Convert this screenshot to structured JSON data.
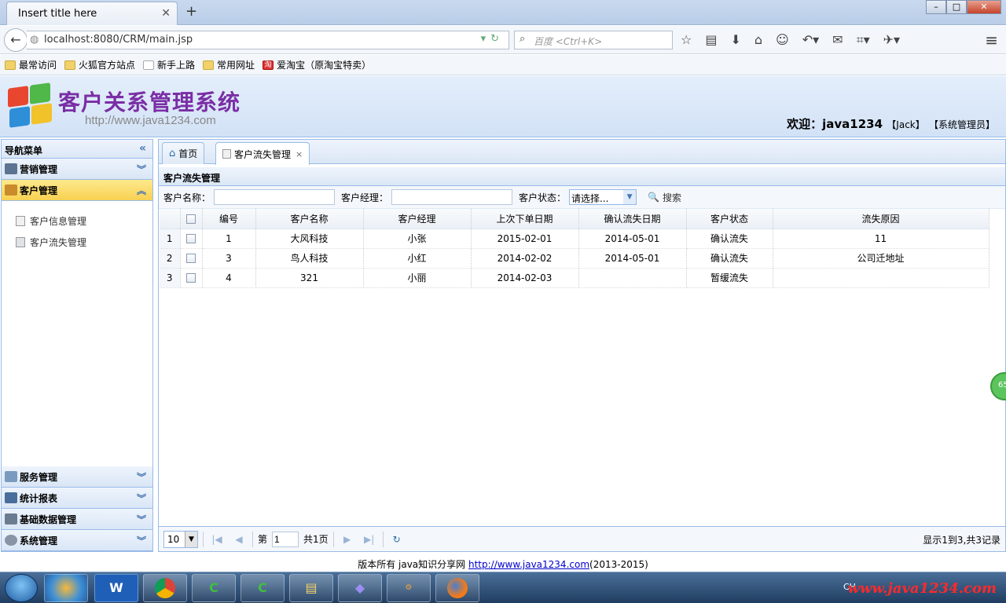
{
  "browser": {
    "tab_title": "Insert title here",
    "tab_close": "✕",
    "new_tab": "+",
    "url": "localhost:8080/CRM/main.jsp",
    "search_placeholder": "百度 <Ctrl+K>",
    "bookmarks": [
      "最常访问",
      "火狐官方站点",
      "新手上路",
      "常用网址",
      "爱淘宝（原淘宝特卖）"
    ]
  },
  "header": {
    "app_title": "客户关系管理系统",
    "app_url": "http://www.java1234.com",
    "welcome": "欢迎：java1234",
    "user_name": "【Jack】",
    "user_role": "【系统管理员】"
  },
  "sidebar": {
    "title": "导航菜单",
    "collapse_icon": "«",
    "sections": [
      {
        "label": "营销管理",
        "arrow": "︾"
      },
      {
        "label": "客户管理",
        "arrow": "︽"
      }
    ],
    "items": [
      "客户信息管理",
      "客户流失管理"
    ],
    "bottom_sections": [
      {
        "label": "服务管理",
        "arrow": "︾"
      },
      {
        "label": "统计报表",
        "arrow": "︾"
      },
      {
        "label": "基础数据管理",
        "arrow": "︾"
      },
      {
        "label": "系统管理",
        "arrow": "︾"
      }
    ]
  },
  "main": {
    "tabs": [
      {
        "label": "首页"
      },
      {
        "label": "客户流失管理",
        "close": "×"
      }
    ],
    "panel_title": "客户流失管理",
    "toolbar": {
      "name_label": "客户名称：",
      "manager_label": "客户经理：",
      "status_label": "客户状态：",
      "status_value": "请选择...",
      "search_label": "搜索"
    },
    "grid": {
      "columns": [
        "编号",
        "客户名称",
        "客户经理",
        "上次下单日期",
        "确认流失日期",
        "客户状态",
        "流失原因"
      ],
      "rows": [
        {
          "rn": "1",
          "id": "1",
          "name": "大风科技",
          "manager": "小张",
          "last_order": "2015-02-01",
          "confirm_date": "2014-05-01",
          "status": "确认流失",
          "reason": "11"
        },
        {
          "rn": "2",
          "id": "3",
          "name": "鸟人科技",
          "manager": "小红",
          "last_order": "2014-02-02",
          "confirm_date": "2014-05-01",
          "status": "确认流失",
          "reason": "公司迁地址"
        },
        {
          "rn": "3",
          "id": "4",
          "name": "321",
          "manager": "小丽",
          "last_order": "2014-02-03",
          "confirm_date": "",
          "status": "暂缓流失",
          "reason": ""
        }
      ]
    },
    "pager": {
      "page_size": "10",
      "page_prefix": "第",
      "page_value": "1",
      "page_total": "共1页",
      "info": "显示1到3,共3记录",
      "badge": "65"
    }
  },
  "footer": {
    "prefix": "版本所有 java知识分享网 ",
    "link": "http://www.java1234.com",
    "suffix": "(2013-2015)"
  },
  "taskbar": {
    "apps": [
      "W",
      "",
      "",
      "",
      "",
      "",
      "",
      ""
    ],
    "tray_lang": "CH",
    "watermark": "www.java1234.com"
  },
  "colors": {
    "title_purple": "#7a2ea5",
    "active_accordion": "#f8d152",
    "border_blue": "#99bbe8"
  }
}
